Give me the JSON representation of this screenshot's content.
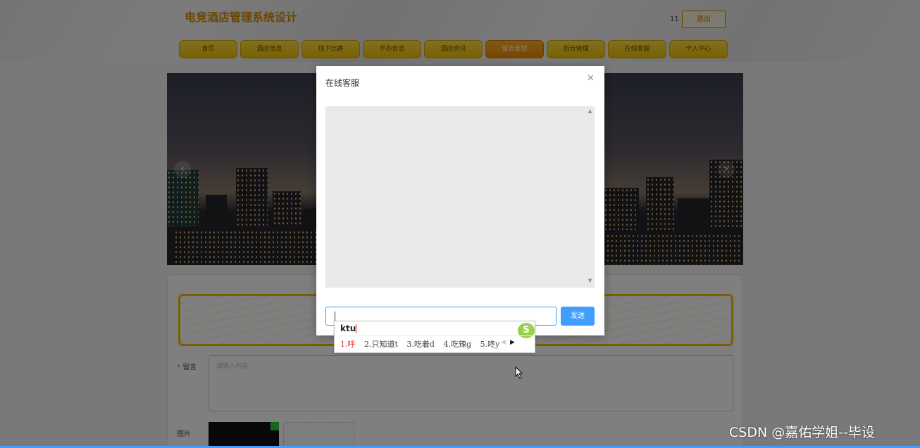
{
  "header": {
    "site_title": "电竞酒店管理系统设计",
    "user_name": "11",
    "logout_label": "退出"
  },
  "nav": {
    "items": [
      "首页",
      "酒店信息",
      "线下比赛",
      "手办信息",
      "酒店资讯",
      "留言反馈",
      "后台管理",
      "在线客服",
      "个人中心"
    ],
    "active_index": 5
  },
  "form": {
    "message_label": "留言",
    "message_placeholder": "请输入内容",
    "image_label": "图片"
  },
  "dialog": {
    "title": "在线客服",
    "close_icon": "close-icon",
    "send_label": "发送",
    "input_value": ""
  },
  "ime": {
    "composition": "ktu",
    "candidates": [
      "1.呼",
      "2.只知道t",
      "3.吃着d",
      "4.吃辣g",
      "5.咚y"
    ]
  },
  "watermark": "CSDN @嘉佑学姐--毕设",
  "colors": {
    "nav_bg": "#f4c300",
    "nav_active": "#f08a00",
    "primary": "#409eff",
    "title": "#d98c00"
  }
}
